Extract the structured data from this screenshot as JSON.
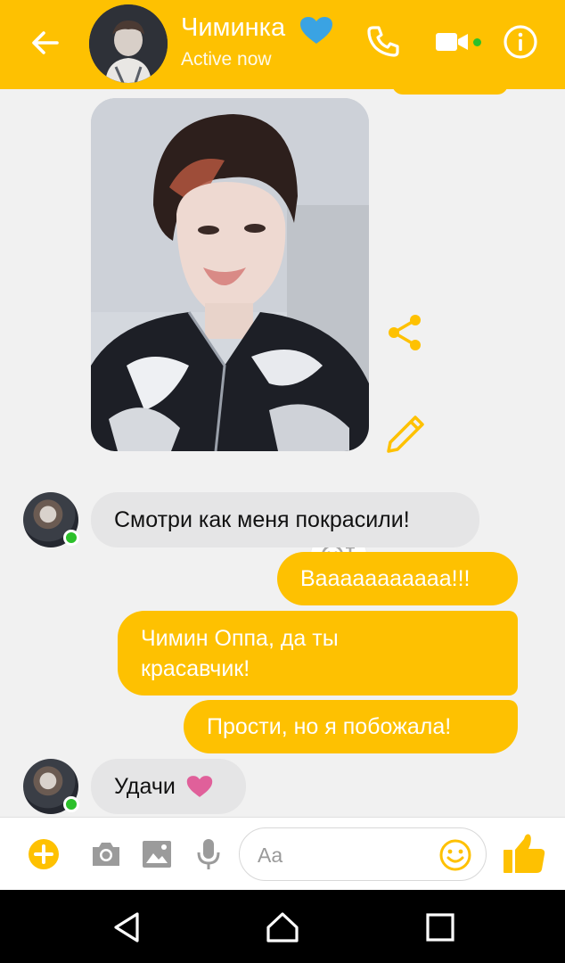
{
  "header": {
    "back_icon": "arrow-left-icon",
    "contact_name": "Чиминка",
    "name_emoji": "blue-heart-icon",
    "status": "Active now",
    "call_icon": "phone-icon",
    "video_icon": "video-camera-icon",
    "info_icon": "info-icon"
  },
  "messages": [
    {
      "direction": "in",
      "text": "Смотри как меня покрасили!"
    },
    {
      "direction": "out",
      "text": "Вааааааааааа!!!"
    },
    {
      "direction": "out",
      "text": "Чимин Оппа, да ты красавчик!"
    },
    {
      "direction": "out",
      "text": "Прости,  но я побожала!"
    },
    {
      "direction": "in",
      "text": "Удачи",
      "emoji": "pink-heart-icon"
    }
  ],
  "composer": {
    "placeholder": "Aa",
    "value": ""
  },
  "colors": {
    "accent": "#fec101",
    "incoming_bubble": "#e5e5e6",
    "online": "#2cc02a",
    "heart_blue": "#3aa3e3",
    "heart_pink": "#e0609a"
  }
}
